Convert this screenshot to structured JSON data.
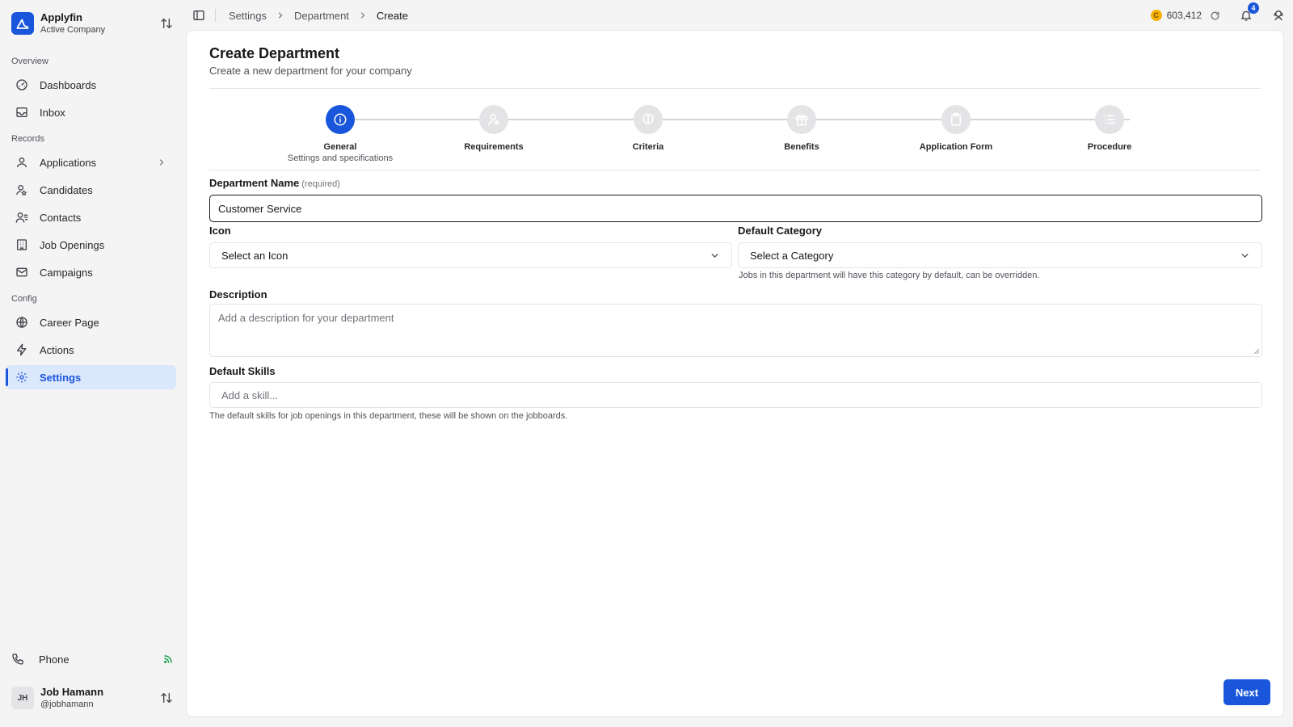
{
  "org": {
    "name": "Applyfin",
    "subtitle": "Active Company"
  },
  "nav": {
    "overview_label": "Overview",
    "records_label": "Records",
    "config_label": "Config",
    "dashboards": "Dashboards",
    "inbox": "Inbox",
    "applications": "Applications",
    "candidates": "Candidates",
    "contacts": "Contacts",
    "job_openings": "Job Openings",
    "campaigns": "Campaigns",
    "career_page": "Career Page",
    "actions": "Actions",
    "settings": "Settings",
    "phone": "Phone"
  },
  "user": {
    "initials": "JH",
    "name": "Job Hamann",
    "handle": "@jobhamann"
  },
  "breadcrumb": [
    "Settings",
    "Department",
    "Create"
  ],
  "topbar": {
    "credits": "603,412",
    "coin_glyph": "C",
    "notification_count": "4"
  },
  "page": {
    "title": "Create Department",
    "subtitle": "Create a new department for your company"
  },
  "steps": [
    {
      "label": "General",
      "sublabel": "Settings and specifications",
      "icon": "info-icon",
      "active": true
    },
    {
      "label": "Requirements",
      "sublabel": "",
      "icon": "user-star-icon",
      "active": false
    },
    {
      "label": "Criteria",
      "sublabel": "",
      "icon": "brain-icon",
      "active": false
    },
    {
      "label": "Benefits",
      "sublabel": "",
      "icon": "gift-icon",
      "active": false
    },
    {
      "label": "Application Form",
      "sublabel": "",
      "icon": "clipboard-icon",
      "active": false
    },
    {
      "label": "Procedure",
      "sublabel": "",
      "icon": "list-icon",
      "active": false
    }
  ],
  "form": {
    "department_name_label": "Department Name",
    "required_text": "(required)",
    "department_name_value": "Customer Service",
    "icon_label": "Icon",
    "icon_placeholder": "Select an Icon",
    "category_label": "Default Category",
    "category_placeholder": "Select a Category",
    "category_helper": "Jobs in this department will have this category by default, can be overridden.",
    "description_label": "Description",
    "description_placeholder": "Add a description for your department",
    "skills_label": "Default Skills",
    "skills_placeholder": "Add a skill...",
    "skills_helper": "The default skills for job openings in this department, these will be shown on the jobboards."
  },
  "next_button": "Next",
  "colors": {
    "accent": "#1a56db",
    "coin": "#f5b301",
    "signal": "#16a34a"
  }
}
